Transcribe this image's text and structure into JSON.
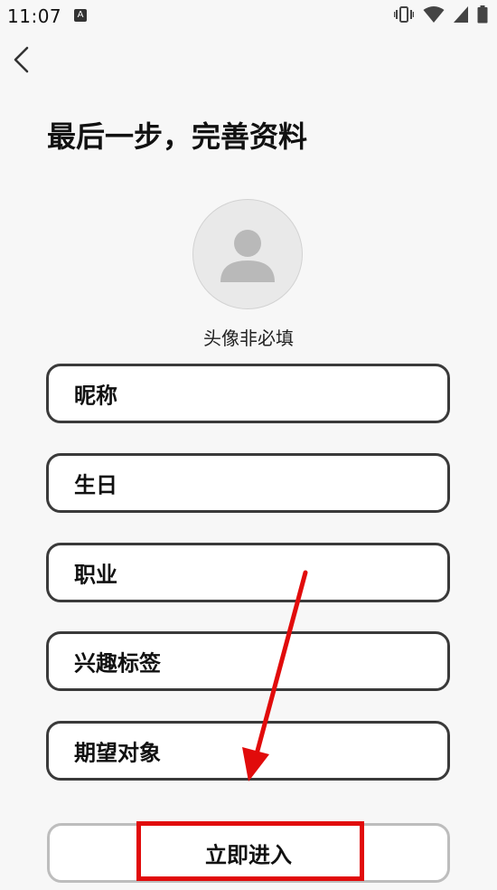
{
  "status_bar": {
    "time": "11:07",
    "notification_icon": "A"
  },
  "header": {
    "back_icon": "chevron-left"
  },
  "title": "最后一步，完善资料",
  "avatar": {
    "hint": "头像非必填"
  },
  "fields": [
    {
      "label": "昵称"
    },
    {
      "label": "生日"
    },
    {
      "label": "职业"
    },
    {
      "label": "兴趣标签"
    },
    {
      "label": "期望对象"
    }
  ],
  "submit": {
    "label": "立即进入"
  },
  "colors": {
    "annotation": "#e10b0b",
    "field_border": "#3a3a3a",
    "button_border": "#bdbdbd"
  }
}
